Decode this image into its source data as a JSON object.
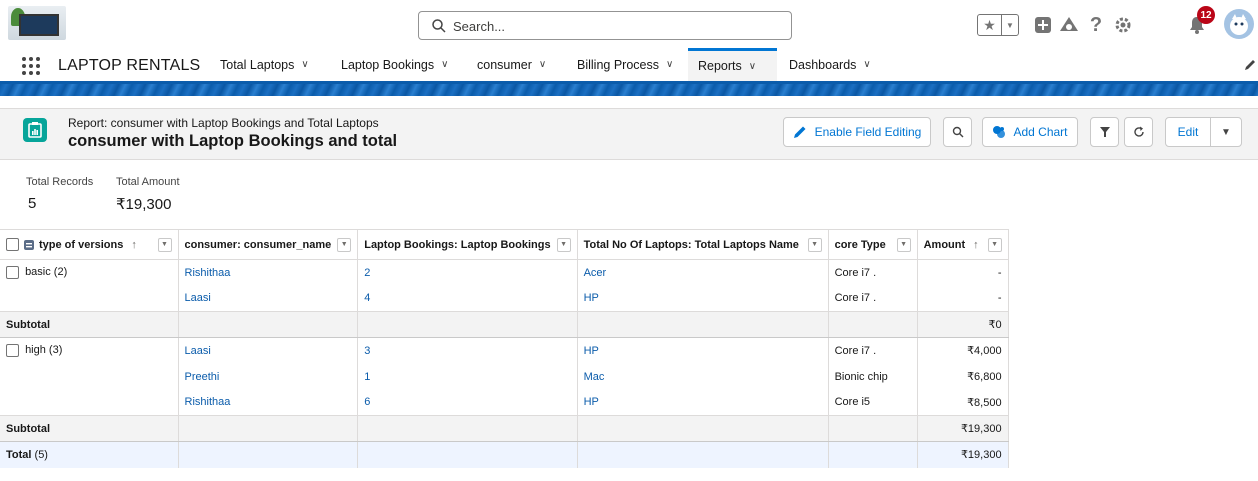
{
  "header": {
    "search_placeholder": "Search...",
    "notification_count": "12"
  },
  "nav": {
    "app_name": "LAPTOP RENTALS",
    "tabs": [
      {
        "label": "Total Laptops"
      },
      {
        "label": "Laptop Bookings"
      },
      {
        "label": "consumer"
      },
      {
        "label": "Billing Process"
      },
      {
        "label": "Reports"
      },
      {
        "label": "Dashboards"
      }
    ],
    "active_tab": "Reports"
  },
  "report": {
    "subtitle": "Report: consumer with Laptop Bookings and Total Laptops",
    "title": "consumer with Laptop Bookings and total",
    "buttons": {
      "enable_field_editing": "Enable Field Editing",
      "add_chart": "Add Chart",
      "edit": "Edit"
    }
  },
  "summary": {
    "total_records_label": "Total Records",
    "total_records_value": "5",
    "total_amount_label": "Total Amount",
    "total_amount_value": "₹19,300"
  },
  "table": {
    "columns": [
      "type of versions",
      "consumer: consumer_name",
      "Laptop Bookings: Laptop Bookings",
      "Total No Of Laptops: Total Laptops Name",
      "core Type",
      "Amount"
    ],
    "groups": [
      {
        "label": "basic (2)",
        "rows": [
          {
            "consumer": "Rishithaa",
            "bookings": "2",
            "laptop": "Acer",
            "core": "Core i7 .",
            "amount": "-"
          },
          {
            "consumer": "Laasi",
            "bookings": "4",
            "laptop": "HP",
            "core": "Core i7 .",
            "amount": "-"
          }
        ],
        "subtotal_label": "Subtotal",
        "subtotal_amount": "₹0"
      },
      {
        "label": "high (3)",
        "rows": [
          {
            "consumer": "Laasi",
            "bookings": "3",
            "laptop": "HP",
            "core": "Core i7 .",
            "amount": "₹4,000"
          },
          {
            "consumer": "Preethi",
            "bookings": "1",
            "laptop": "Mac",
            "core": "Bionic chip",
            "amount": "₹6,800"
          },
          {
            "consumer": "Rishithaa",
            "bookings": "6",
            "laptop": "HP",
            "core": "Core i5",
            "amount": "₹8,500"
          }
        ],
        "subtotal_label": "Subtotal",
        "subtotal_amount": "₹19,300"
      }
    ],
    "total_label": "Total",
    "total_count": "(5)",
    "total_amount": "₹19,300"
  },
  "colors": {
    "brand_blue": "#0176d3",
    "nav_band": "#0b5cab",
    "report_icon": "#06a59a",
    "badge_red": "#ba0517"
  },
  "icons": [
    "app-logo",
    "search-icon",
    "star-icon",
    "chevron-down-icon",
    "plus-icon",
    "trailhead-icon",
    "help-icon",
    "gear-icon",
    "bell-icon",
    "avatar",
    "app-launcher-icon",
    "pencil-icon",
    "report-icon",
    "refresh-icon",
    "filter-icon",
    "chart-icon"
  ]
}
